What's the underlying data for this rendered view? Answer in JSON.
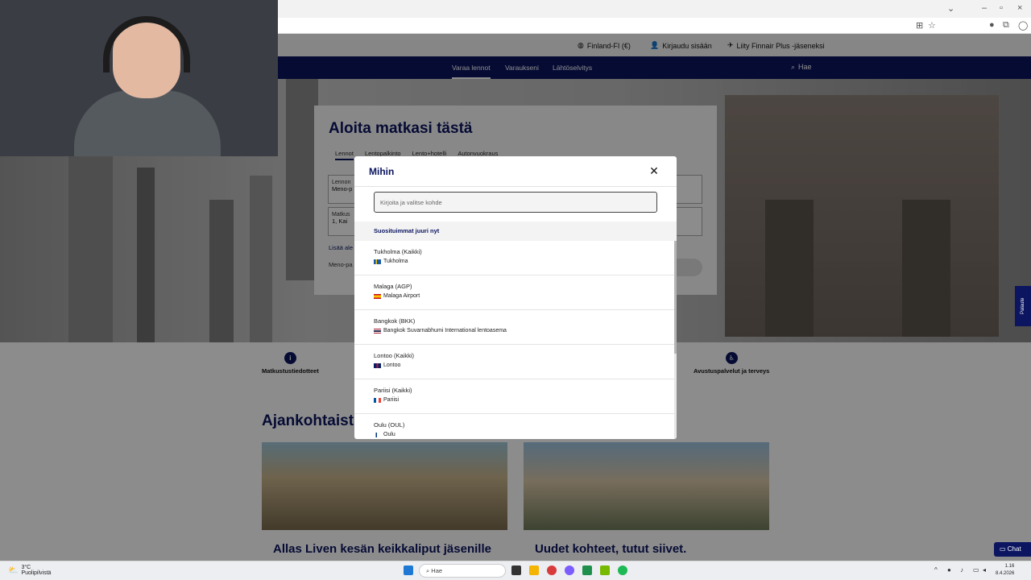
{
  "browser": {
    "minimize": "–",
    "maximize": "▫",
    "close": "×",
    "dropdown": "⌄"
  },
  "site": {
    "util": {
      "locale": "Finland-FI (€)",
      "login": "Kirjaudu sisään",
      "join": "Liity Finnair Plus -jäseneksi"
    },
    "nav": {
      "book": "Varaa lennot",
      "bookings": "Varaukseni",
      "checkin": "Lähtöselvitys",
      "search": "Hae"
    },
    "booking": {
      "title": "Aloita matkasi tästä",
      "tabs": [
        "Lennot",
        "Lentopalkinto",
        "Lento+hotelli",
        "Autonvuokraus"
      ],
      "field1_label": "Lennon",
      "field1_value": "Meno-p",
      "field2_label": "Matkus",
      "field2_value": "1, Kai",
      "link": "Lisää ale",
      "meno": "Meno-pa"
    },
    "services": {
      "left": "Matkustustiedotteet",
      "right": "Avustuspalvelut ja terveys"
    },
    "section_title": "Ajankohtaist",
    "news": [
      {
        "title": "Allas Liven kesän keikkaliput jäsenille"
      },
      {
        "title": "Uudet kohteet, tutut siivet."
      }
    ],
    "feedback": "Palaute",
    "chat": "Chat"
  },
  "modal": {
    "title": "Mihin",
    "close_label": "✕",
    "input_placeholder": "Kirjoita ja valitse kohde",
    "popular_header": "Suosituimmat juuri nyt",
    "destinations": [
      {
        "name": "Tukholma (Kaikki)",
        "sub": "Tukholma",
        "flag": "se"
      },
      {
        "name": "Malaga (AGP)",
        "sub": "Malaga Airport",
        "flag": "es"
      },
      {
        "name": "Bangkok (BKK)",
        "sub": "Bangkok Suvarnabhumi International lentoasema",
        "flag": "th"
      },
      {
        "name": "Lontoo (Kaikki)",
        "sub": "Lontoo",
        "flag": "gb"
      },
      {
        "name": "Pariisi (Kaikki)",
        "sub": "Pariisi",
        "flag": "fr"
      },
      {
        "name": "Oulu (OUL)",
        "sub": "Oulu",
        "flag": "fi"
      }
    ]
  },
  "taskbar": {
    "weather_temp": "3°C",
    "weather_desc": "Puolipilvistä",
    "search_label": "Hae",
    "time": "1.16",
    "date": "8.4.2026"
  },
  "colors": {
    "brand": "#0b1560"
  }
}
